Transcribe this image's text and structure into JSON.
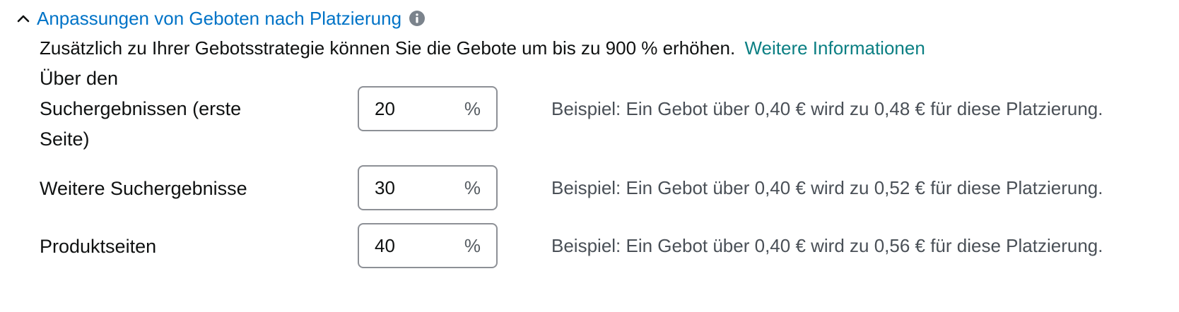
{
  "section": {
    "title": "Anpassungen von Geboten nach Platzierung",
    "description": "Zusätzlich zu Ihrer Gebotsstrategie können Sie die Gebote um bis zu 900 % erhöhen.",
    "more_link": "Weitere Informationen"
  },
  "colors": {
    "title": "#0073c7",
    "link": "#0b7f83",
    "text": "#0f1111",
    "muted": "#4a5057",
    "border": "#8d9096",
    "icon": "#7b838c"
  },
  "placements": [
    {
      "label_lines": [
        "Über den",
        "Suchergebnissen (erste",
        "Seite)"
      ],
      "value": "20",
      "suffix": "%",
      "example": "Beispiel: Ein Gebot über 0,40 € wird zu 0,48 € für diese Platzierung."
    },
    {
      "label": "Weitere Suchergebnisse",
      "value": "30",
      "suffix": "%",
      "example": "Beispiel: Ein Gebot über 0,40 € wird zu 0,52 € für diese Platzierung."
    },
    {
      "label": "Produktseiten",
      "value": "40",
      "suffix": "%",
      "example": "Beispiel: Ein Gebot über 0,40 € wird zu 0,56 € für diese Platzierung."
    }
  ]
}
